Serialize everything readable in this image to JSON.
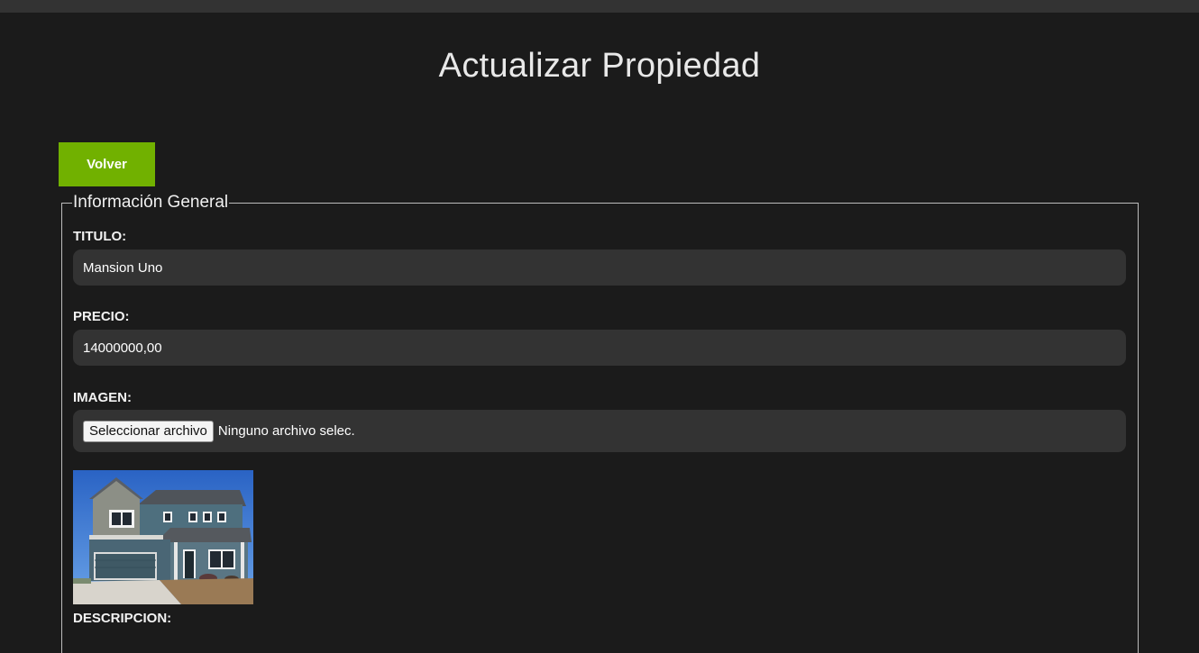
{
  "header": {
    "title": "Actualizar Propiedad"
  },
  "actions": {
    "back_label": "Volver"
  },
  "form": {
    "legend": "Información General",
    "titulo": {
      "label": "TITULO:",
      "value": "Mansion Uno"
    },
    "precio": {
      "label": "PRECIO:",
      "value": "14000000,00"
    },
    "imagen": {
      "label": "IMAGEN:",
      "button_label": "Seleccionar archivo",
      "status": "Ninguno archivo selec."
    },
    "descripcion": {
      "label": "DESCRIPCION:"
    }
  },
  "colors": {
    "background": "#1b1b1b",
    "topbar": "#333333",
    "input_bg": "#333333",
    "accent_green": "#71b100"
  },
  "icons": {
    "preview_image": "house-photo"
  }
}
